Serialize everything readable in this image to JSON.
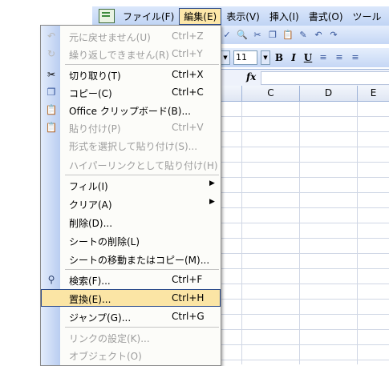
{
  "menubar": {
    "items": [
      "ファイル(F)",
      "編集(E)",
      "表示(V)",
      "挿入(I)",
      "書式(O)",
      "ツール"
    ]
  },
  "formatting": {
    "font_size": "11",
    "bold": "B",
    "italic": "I",
    "underline": "U",
    "fx": "fx"
  },
  "columns": [
    "C",
    "D",
    "E"
  ],
  "edit_menu": {
    "undo": {
      "label": "元に戻せません(U)",
      "shortcut": "Ctrl+Z"
    },
    "redo": {
      "label": "繰り返しできません(R)",
      "shortcut": "Ctrl+Y"
    },
    "cut": {
      "label": "切り取り(T)",
      "shortcut": "Ctrl+X"
    },
    "copy": {
      "label": "コピー(C)",
      "shortcut": "Ctrl+C"
    },
    "clipboard": {
      "label": "Office クリップボード(B)..."
    },
    "paste": {
      "label": "貼り付け(P)",
      "shortcut": "Ctrl+V"
    },
    "paste_special": {
      "label": "形式を選択して貼り付け(S)..."
    },
    "paste_hyperlink": {
      "label": "ハイパーリンクとして貼り付け(H)"
    },
    "fill": {
      "label": "フィル(I)"
    },
    "clear": {
      "label": "クリア(A)"
    },
    "delete": {
      "label": "削除(D)..."
    },
    "delete_sheet": {
      "label": "シートの削除(L)"
    },
    "move_copy_sheet": {
      "label": "シートの移動またはコピー(M)..."
    },
    "find": {
      "label": "検索(F)...",
      "shortcut": "Ctrl+F"
    },
    "replace": {
      "label": "置換(E)...",
      "shortcut": "Ctrl+H"
    },
    "goto": {
      "label": "ジャンプ(G)...",
      "shortcut": "Ctrl+G"
    },
    "links": {
      "label": "リンクの設定(K)..."
    },
    "object": {
      "label": "オブジェクト(O)"
    }
  },
  "colors": {
    "highlight": "#fbe5a5",
    "menubar": "#c0d4f4"
  }
}
